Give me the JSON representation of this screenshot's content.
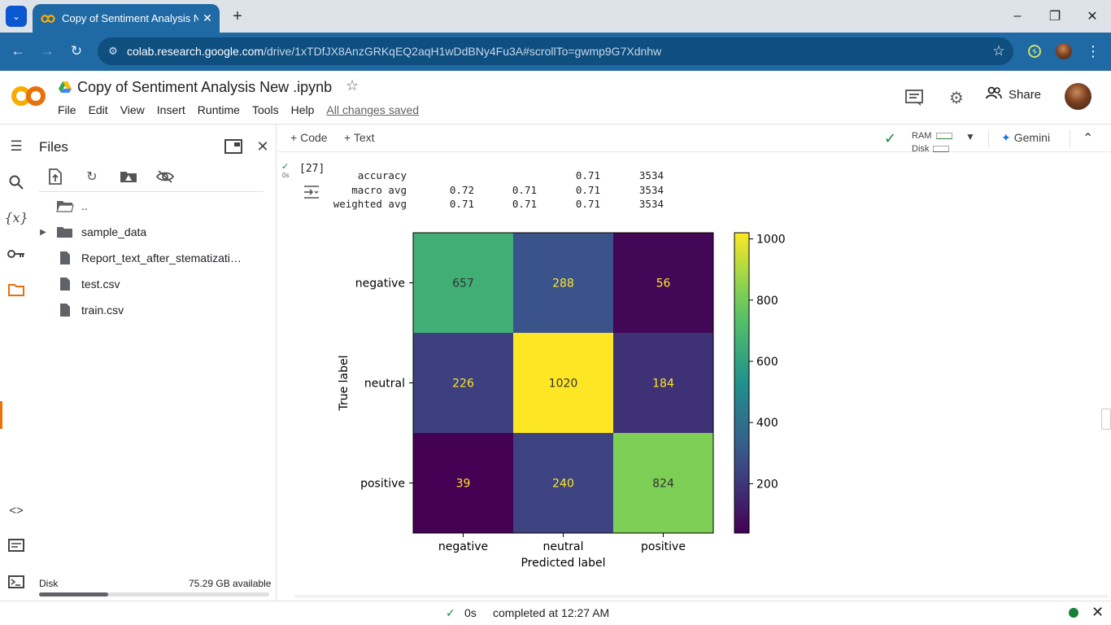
{
  "browser": {
    "tab_title": "Copy of Sentiment Analysis New .ipynb - Colab",
    "url_host": "colab.research.google.com",
    "url_path": "/drive/1xTDfJX8AnzGRKqEQ2aqH1wDdBNy4Fu3A#scrollTo=gwmp9G7Xdnhw",
    "accent": "#1f6aa5"
  },
  "colab": {
    "doc_title": "Copy of Sentiment Analysis New .ipynb",
    "menu": [
      "File",
      "Edit",
      "View",
      "Insert",
      "Runtime",
      "Tools",
      "Help"
    ],
    "saved_status": "All changes saved",
    "share_label": "Share"
  },
  "files_panel": {
    "title": "Files",
    "items": [
      {
        "label": "..",
        "icon": "folder-open-icon"
      },
      {
        "label": "sample_data",
        "icon": "folder-icon"
      },
      {
        "label": "Report_text_after_stematizatio...",
        "icon": "file-icon"
      },
      {
        "label": "test.csv",
        "icon": "file-icon"
      },
      {
        "label": "train.csv",
        "icon": "file-icon"
      }
    ],
    "disk_label": "Disk",
    "disk_available": "75.29 GB available",
    "disk_used_fraction": 0.3
  },
  "notebook_toolbar": {
    "add_code": "Code",
    "add_text": "Text",
    "ram_label": "RAM",
    "disk_label": "Disk",
    "gemini_label": "Gemini"
  },
  "cell": {
    "exec_count": "[27]",
    "run_time": "0s",
    "report_rows": [
      {
        "label": "accuracy",
        "precision": "",
        "recall": "",
        "f1": "0.71",
        "support": "3534"
      },
      {
        "label": "macro avg",
        "precision": "0.72",
        "recall": "0.71",
        "f1": "0.71",
        "support": "3534"
      },
      {
        "label": "weighted avg",
        "precision": "0.71",
        "recall": "0.71",
        "f1": "0.71",
        "support": "3534"
      }
    ]
  },
  "chart_data": {
    "type": "heatmap",
    "title": "",
    "xlabel": "Predicted label",
    "ylabel": "True label",
    "x_categories": [
      "negative",
      "neutral",
      "positive"
    ],
    "y_categories": [
      "negative",
      "neutral",
      "positive"
    ],
    "values": [
      [
        657,
        288,
        56
      ],
      [
        226,
        1020,
        184
      ],
      [
        39,
        240,
        824
      ]
    ],
    "colormap": "viridis",
    "colorbar_ticks": [
      200,
      400,
      600,
      800,
      1000
    ],
    "vmin": 39,
    "vmax": 1020
  },
  "status_bar": {
    "duration": "0s",
    "message": "completed at 12:27 AM"
  }
}
